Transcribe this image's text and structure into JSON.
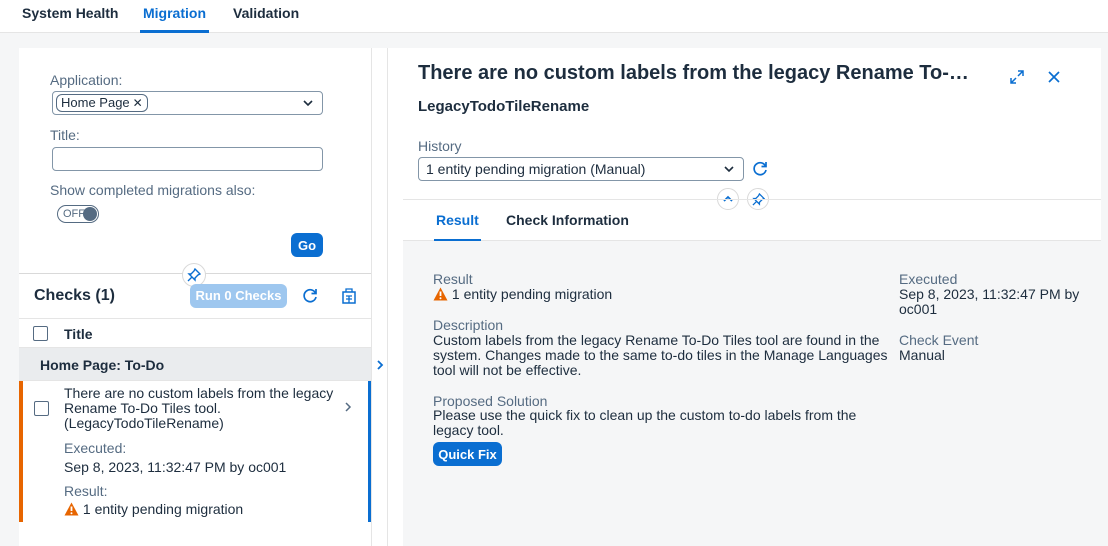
{
  "top_tabs": [
    "System Health",
    "Migration",
    "Validation"
  ],
  "filters": {
    "application_label": "Application:",
    "application_token": "Home Page",
    "title_label": "Title:",
    "title_value": "",
    "show_completed_label": "Show completed migrations also:",
    "switch_state": "OFF",
    "go_label": "Go"
  },
  "checks": {
    "title": "Checks (1)",
    "run_label": "Run 0 Checks",
    "column_title": "Title",
    "group_label": "Home Page: To-Do",
    "item": {
      "line1": "There are no custom labels from the legacy",
      "line2": "Rename To-Do Tiles tool.",
      "line3": "(LegacyTodoTileRename)",
      "executed_label": "Executed:",
      "executed_value": "Sep 8, 2023, 11:32:47 PM by oc001",
      "result_label": "Result:",
      "result_value": "1 entity pending migration"
    }
  },
  "detail": {
    "title": "There are no custom labels from the legacy Rename To-D…",
    "subtitle": "LegacyTodoTileRename",
    "history_label": "History",
    "history_value": "1 entity pending migration (Manual)",
    "tabs": [
      "Result",
      "Check Information"
    ],
    "result_label": "Result",
    "result_value": "1 entity pending migration",
    "description_label": "Description",
    "description_lines": [
      "Custom labels from the legacy Rename To-Do Tiles tool are found in the",
      "system. Changes made to the same to-do tiles in the Manage Languages",
      "tool will not be effective."
    ],
    "solution_label": "Proposed Solution",
    "solution_lines": [
      "Please use the quick fix to clean up the custom to-do labels from the",
      "legacy tool."
    ],
    "quick_fix_label": "Quick Fix",
    "executed_label": "Executed",
    "executed_lines": [
      "Sep 8, 2023, 11:32:47 PM by",
      "oc001"
    ],
    "check_event_label": "Check Event",
    "check_event_value": "Manual"
  },
  "colors": {
    "accent": "#0a6ed1",
    "warning": "#e76500",
    "warning_text": "#aa5808"
  }
}
